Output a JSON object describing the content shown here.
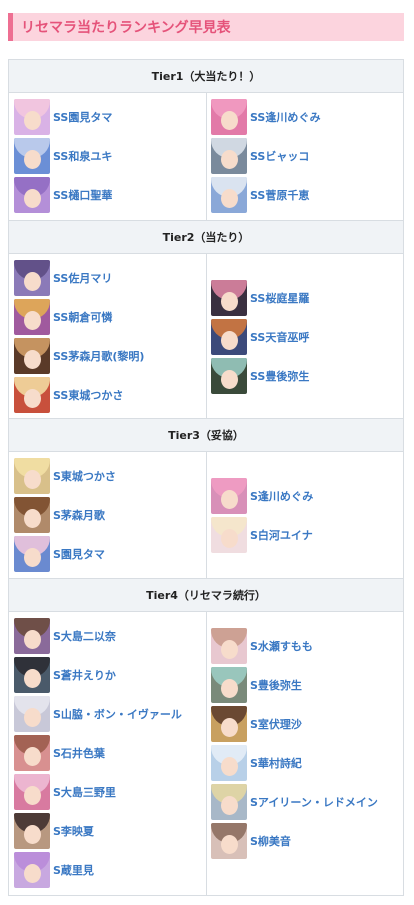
{
  "page_title": "リセマラ当たりランキング早見表",
  "tiers": [
    {
      "header": "Tier1（大当たり！）",
      "left": [
        {
          "name": "SS園見タマ",
          "bg": "#d9b2e6",
          "hair": "#f5c8dd"
        },
        {
          "name": "SS和泉ユキ",
          "bg": "#6b8fd6",
          "hair": "#c7d3ee"
        },
        {
          "name": "SS樋口聖華",
          "bg": "#b48fd8",
          "hair": "#8f6bc2"
        }
      ],
      "right": [
        {
          "name": "SS逢川めぐみ",
          "bg": "#e27aa8",
          "hair": "#f29ec3"
        },
        {
          "name": "SSビャッコ",
          "bg": "#7a8a9c",
          "hair": "#dfe5ee"
        },
        {
          "name": "SS菅原千恵",
          "bg": "#8aa8d8",
          "hair": "#e8edf5"
        }
      ]
    },
    {
      "header": "Tier2（当たり）",
      "left": [
        {
          "name": "SS佐月マリ",
          "bg": "#8b7ab8",
          "hair": "#5a4a80"
        },
        {
          "name": "SS朝倉可憐",
          "bg": "#a05a9e",
          "hair": "#e7b34d"
        },
        {
          "name": "SS茅森月歌(黎明)",
          "bg": "#5a3a28",
          "hair": "#d8a36a"
        },
        {
          "name": "SS東城つかさ",
          "bg": "#c8503c",
          "hair": "#f4e2a6"
        }
      ],
      "right": [
        {
          "name": "SS桜庭星羅",
          "bg": "#3a3040",
          "hair": "#e58aa8"
        },
        {
          "name": "SS天音巫呼",
          "bg": "#3c4a7a",
          "hair": "#d97a3a"
        },
        {
          "name": "SS豊後弥生",
          "bg": "#3a4a3a",
          "hair": "#9fd0c8"
        }
      ]
    },
    {
      "header": "Tier3（妥協）",
      "left": [
        {
          "name": "S東城つかさ",
          "bg": "#d8c08a",
          "hair": "#f4e2a6"
        },
        {
          "name": "S茅森月歌",
          "bg": "#b08a6a",
          "hair": "#7a4a2a"
        },
        {
          "name": "S園見タマ",
          "bg": "#6a8ad0",
          "hair": "#f5c8dd"
        }
      ],
      "right": [
        {
          "name": "S逢川めぐみ",
          "bg": "#d890b8",
          "hair": "#f29ec3"
        },
        {
          "name": "S白河ユイナ",
          "bg": "#f0dde0",
          "hair": "#f6e8c8"
        }
      ]
    },
    {
      "header": "Tier4（リセマラ続行）",
      "left": [
        {
          "name": "S大島二以奈",
          "bg": "#8a6a9a",
          "hair": "#6a4a3a"
        },
        {
          "name": "S蒼井えりか",
          "bg": "#4a5a6a",
          "hair": "#2a2a30"
        },
        {
          "name": "S山脇・ボン・イヴァール",
          "bg": "#c8c8d8",
          "hair": "#e8e8f0"
        },
        {
          "name": "S石井色葉",
          "bg": "#d89090",
          "hair": "#9a5a4a"
        },
        {
          "name": "S大島三野里",
          "bg": "#d87aa0",
          "hair": "#f0c0d8"
        },
        {
          "name": "S李映夏",
          "bg": "#b89880",
          "hair": "#3a2a2a"
        },
        {
          "name": "S蔵里見",
          "bg": "#c8a8e0",
          "hair": "#b88ad8"
        }
      ],
      "right": [
        {
          "name": "S水瀬すもも",
          "bg": "#e8c8d0",
          "hair": "#c89a8a"
        },
        {
          "name": "S豊後弥生",
          "bg": "#7a8a7a",
          "hair": "#9fd0c8"
        },
        {
          "name": "S室伏理沙",
          "bg": "#c8a060",
          "hair": "#5a3a2a"
        },
        {
          "name": "S華村詩紀",
          "bg": "#b8d0e8",
          "hair": "#e8f0f8"
        },
        {
          "name": "Sアイリーン・レドメイン",
          "bg": "#a8b8c8",
          "hair": "#e8d8a0"
        },
        {
          "name": "S柳美音",
          "bg": "#d8c0b8",
          "hair": "#8a6a5a"
        }
      ]
    }
  ]
}
